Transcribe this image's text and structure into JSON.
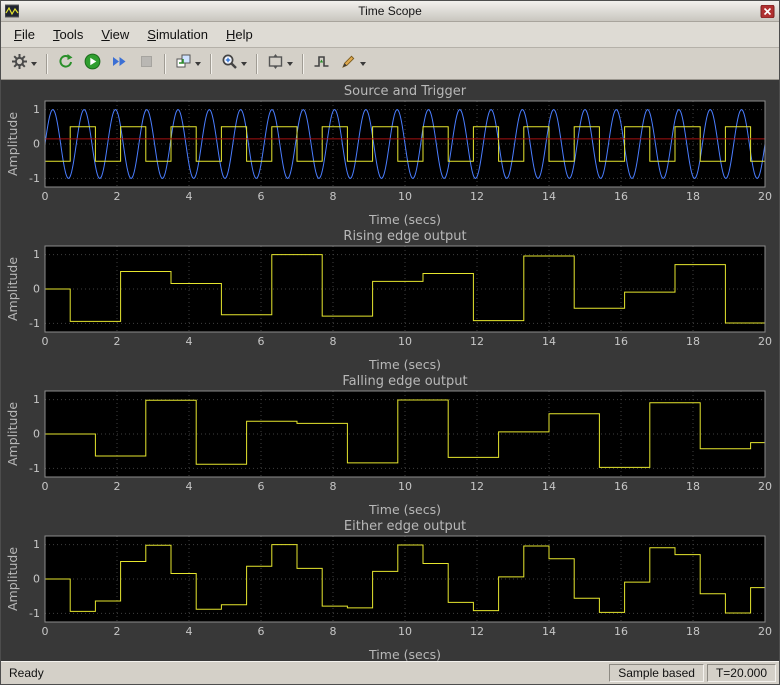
{
  "window": {
    "title": "Time Scope"
  },
  "menu": {
    "items": [
      {
        "label": "File",
        "mnemonic": "F",
        "rest": "ile"
      },
      {
        "label": "Tools",
        "mnemonic": "T",
        "rest": "ools"
      },
      {
        "label": "View",
        "mnemonic": "V",
        "rest": "iew"
      },
      {
        "label": "Simulation",
        "mnemonic": "S",
        "rest": "imulation"
      },
      {
        "label": "Help",
        "mnemonic": "H",
        "rest": "elp"
      }
    ]
  },
  "toolbar": {
    "buttons": [
      {
        "id": "settings",
        "dropdown": true
      },
      {
        "id": "restart",
        "dropdown": false
      },
      {
        "id": "run",
        "dropdown": false
      },
      {
        "id": "step-forward",
        "dropdown": false
      },
      {
        "id": "stop",
        "dropdown": false,
        "disabled": true
      },
      {
        "id": "stepping-options",
        "dropdown": true
      },
      {
        "id": "zoom",
        "dropdown": true
      },
      {
        "id": "fit-axes",
        "dropdown": true
      },
      {
        "id": "trigger",
        "dropdown": false
      },
      {
        "id": "measurements",
        "dropdown": true
      }
    ]
  },
  "statusbar": {
    "ready": "Ready",
    "sample_mode": "Sample based",
    "time": "T=20.000"
  },
  "colors": {
    "canvas_bg": "#383838",
    "plot_bg": "#000000",
    "grid": "#3f3f3f",
    "axis": "#8c8c8c",
    "tick": "#c6c6c6",
    "title": "#b8b8b8",
    "source_blue": "#4a7dff",
    "trigger_yellow": "#e6e62e",
    "trigger_level_red": "#a51212"
  },
  "chart_data": [
    {
      "type": "line",
      "title": "Source and Trigger",
      "xlabel": "Time (secs)",
      "ylabel": "Amplitude",
      "xlim": [
        0,
        20
      ],
      "ylim": [
        -1.25,
        1.25
      ],
      "xticks": [
        0,
        2,
        4,
        6,
        8,
        10,
        12,
        14,
        16,
        18,
        20
      ],
      "yticks": [
        -1,
        0,
        1
      ],
      "series": [
        {
          "name": "source-sine",
          "waveform": "sine",
          "color": "#4a7dff",
          "amplitude": 1,
          "frequency_hz": 1.15
        },
        {
          "name": "trigger-square",
          "waveform": "square",
          "color": "#e6e62e",
          "amplitude": 0.5,
          "period": 1.4,
          "high_start": 0.7
        },
        {
          "name": "trigger-level",
          "waveform": "constant",
          "color": "#a51212",
          "value": 0.15
        }
      ]
    },
    {
      "type": "line",
      "title": "Rising edge output",
      "xlabel": "Time (secs)",
      "ylabel": "Amplitude",
      "xlim": [
        0,
        20
      ],
      "ylim": [
        -1.25,
        1.25
      ],
      "xticks": [
        0,
        2,
        4,
        6,
        8,
        10,
        12,
        14,
        16,
        18,
        20
      ],
      "yticks": [
        -1,
        0,
        1
      ],
      "series": [
        {
          "name": "rising-edge-output",
          "waveform": "step",
          "color": "#e6e62e",
          "points": [
            [
              0,
              0
            ],
            [
              0.7,
              -0.94
            ],
            [
              2.1,
              0.51
            ],
            [
              3.5,
              0.16
            ],
            [
              4.9,
              -0.75
            ],
            [
              6.3,
              1.0
            ],
            [
              7.7,
              -0.79
            ],
            [
              9.1,
              0.22
            ],
            [
              10.5,
              0.45
            ],
            [
              11.9,
              -0.92
            ],
            [
              13.3,
              0.96
            ],
            [
              14.7,
              -0.56
            ],
            [
              16.1,
              -0.09
            ],
            [
              17.5,
              0.71
            ],
            [
              18.9,
              -0.99
            ]
          ]
        }
      ]
    },
    {
      "type": "line",
      "title": "Falling edge output",
      "xlabel": "Time (secs)",
      "ylabel": "Amplitude",
      "xlim": [
        0,
        20
      ],
      "ylim": [
        -1.25,
        1.25
      ],
      "xticks": [
        0,
        2,
        4,
        6,
        8,
        10,
        12,
        14,
        16,
        18,
        20
      ],
      "yticks": [
        -1,
        0,
        1
      ],
      "series": [
        {
          "name": "falling-edge-output",
          "waveform": "step",
          "color": "#e6e62e",
          "points": [
            [
              0,
              0
            ],
            [
              1.4,
              -0.64
            ],
            [
              2.8,
              0.98
            ],
            [
              4.2,
              -0.88
            ],
            [
              5.6,
              0.37
            ],
            [
              7.0,
              0.31
            ],
            [
              8.4,
              -0.84
            ],
            [
              9.8,
              0.99
            ],
            [
              11.2,
              -0.68
            ],
            [
              12.6,
              0.06
            ],
            [
              14.0,
              0.59
            ],
            [
              15.4,
              -0.97
            ],
            [
              16.8,
              0.91
            ],
            [
              18.2,
              -0.43
            ],
            [
              19.6,
              -0.25
            ]
          ]
        }
      ]
    },
    {
      "type": "line",
      "title": "Either edge output",
      "xlabel": "Time (secs)",
      "ylabel": "Amplitude",
      "xlim": [
        0,
        20
      ],
      "ylim": [
        -1.25,
        1.25
      ],
      "xticks": [
        0,
        2,
        4,
        6,
        8,
        10,
        12,
        14,
        16,
        18,
        20
      ],
      "yticks": [
        -1,
        0,
        1
      ],
      "series": [
        {
          "name": "either-edge-output",
          "waveform": "step",
          "color": "#e6e62e",
          "points": [
            [
              0,
              0
            ],
            [
              0.7,
              -0.94
            ],
            [
              1.4,
              -0.64
            ],
            [
              2.1,
              0.51
            ],
            [
              2.8,
              0.98
            ],
            [
              3.5,
              0.16
            ],
            [
              4.2,
              -0.88
            ],
            [
              4.9,
              -0.75
            ],
            [
              5.6,
              0.37
            ],
            [
              6.3,
              1.0
            ],
            [
              7.0,
              0.31
            ],
            [
              7.7,
              -0.79
            ],
            [
              8.4,
              -0.84
            ],
            [
              9.1,
              0.22
            ],
            [
              9.8,
              0.99
            ],
            [
              10.5,
              0.45
            ],
            [
              11.2,
              -0.68
            ],
            [
              11.9,
              -0.92
            ],
            [
              12.6,
              0.06
            ],
            [
              13.3,
              0.96
            ],
            [
              14.0,
              0.59
            ],
            [
              14.7,
              -0.56
            ],
            [
              15.4,
              -0.97
            ],
            [
              16.1,
              -0.09
            ],
            [
              16.8,
              0.91
            ],
            [
              17.5,
              0.71
            ],
            [
              18.2,
              -0.43
            ],
            [
              18.9,
              -0.99
            ],
            [
              19.6,
              -0.25
            ]
          ]
        }
      ]
    }
  ]
}
